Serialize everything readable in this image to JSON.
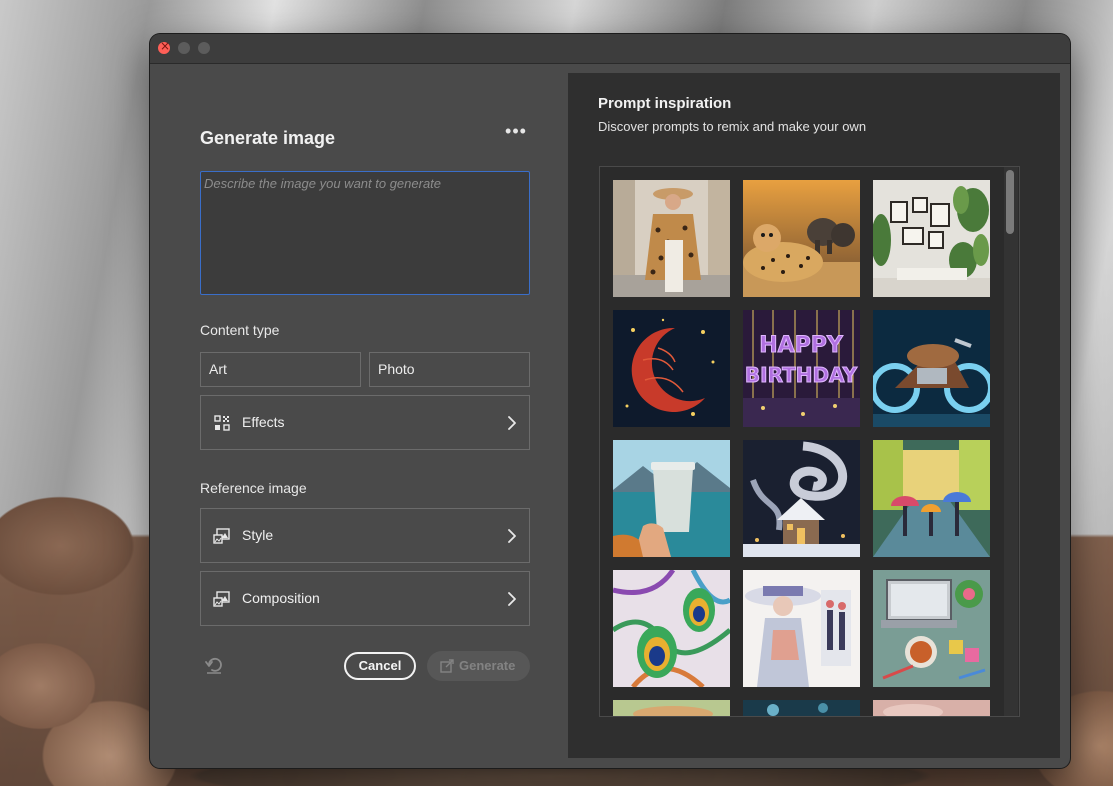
{
  "window": {
    "controls": [
      "close",
      "minimize",
      "maximize"
    ]
  },
  "generate_panel": {
    "title": "Generate image",
    "more_label": "•••",
    "prompt_placeholder": "Describe the image you want to generate",
    "content_type": {
      "label": "Content type",
      "options": [
        "Art",
        "Photo"
      ]
    },
    "effects_label": "Effects",
    "reference_image": {
      "label": "Reference image",
      "style_label": "Style",
      "composition_label": "Composition"
    },
    "cancel_label": "Cancel",
    "generate_label": "Generate"
  },
  "inspiration": {
    "title": "Prompt inspiration",
    "subtitle": "Discover prompts to remix and make your own",
    "thumbnails": [
      "woman-leopard-coat",
      "cheetah-elephants",
      "gallery-wall-plants",
      "red-yarn-moon",
      "happy-birthday-balloons",
      "neon-motorcycle",
      "coffee-cup-lake",
      "snowy-cottage-swirl",
      "rainy-street-umbrellas",
      "peacock-feathers",
      "watercolor-fashion",
      "laptop-desk-tea",
      "partial-row-1",
      "partial-row-2",
      "partial-row-3"
    ]
  },
  "colors": {
    "accent_focus": "#3a6ec9",
    "panel_bg": "#4a4a4a",
    "inspiration_bg": "#2f2f2f"
  }
}
